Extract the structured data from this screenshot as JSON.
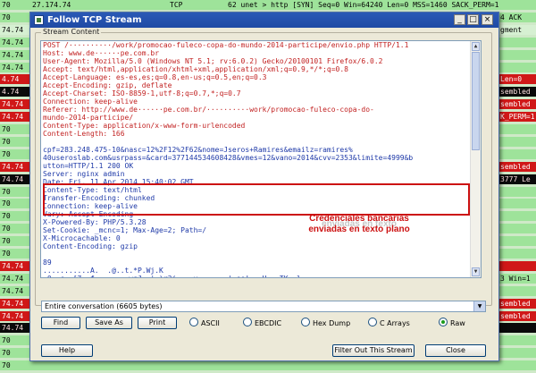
{
  "background_rows": [
    {
      "cls": "c-green",
      "no": "70",
      "src": "27.174.74",
      "proto": "TCP",
      "info": "62 unet > http [SYN] Seq=0 Win=64240 Len=0 MSS=1460 SACK_PERM=1"
    },
    {
      "cls": "c-green",
      "no": "70",
      "src": "",
      "proto": "",
      "info": "4 ACK"
    },
    {
      "cls": "c-pale",
      "no": "74.74",
      "src": "",
      "proto": "",
      "info": "gment"
    },
    {
      "cls": "c-green",
      "no": "74.74",
      "src": "",
      "proto": "",
      "info": ""
    },
    {
      "cls": "c-green",
      "no": "74.74",
      "src": "",
      "proto": "",
      "info": ""
    },
    {
      "cls": "c-green",
      "no": "74.74",
      "src": "",
      "proto": "",
      "info": ""
    },
    {
      "cls": "c-red",
      "no": "4.74",
      "src": "",
      "proto": "",
      "info": "Len=0"
    },
    {
      "cls": "c-black",
      "no": "4.74",
      "src": "",
      "proto": "",
      "info": "sembled"
    },
    {
      "cls": "c-red",
      "no": "74.74",
      "src": "",
      "proto": "",
      "info": "sembled"
    },
    {
      "cls": "c-red",
      "no": "74.74",
      "src": "",
      "proto": "",
      "info": "K_PERM=1"
    },
    {
      "cls": "c-green",
      "no": "70",
      "src": "",
      "proto": "",
      "info": ""
    },
    {
      "cls": "c-green",
      "no": "70",
      "src": "",
      "proto": "",
      "info": ""
    },
    {
      "cls": "c-green",
      "no": "70",
      "src": "",
      "proto": "",
      "info": ""
    },
    {
      "cls": "c-red",
      "no": "74.74",
      "src": "",
      "proto": "",
      "info": "sembled"
    },
    {
      "cls": "c-black",
      "no": "74.74",
      "src": "",
      "proto": "",
      "info": "3777 Le"
    },
    {
      "cls": "c-green",
      "no": "70",
      "src": "",
      "proto": "",
      "info": ""
    },
    {
      "cls": "c-green",
      "no": "70",
      "src": "",
      "proto": "",
      "info": ""
    },
    {
      "cls": "c-green",
      "no": "70",
      "src": "",
      "proto": "",
      "info": ""
    },
    {
      "cls": "c-green",
      "no": "70",
      "src": "",
      "proto": "",
      "info": ""
    },
    {
      "cls": "c-green",
      "no": "70",
      "src": "",
      "proto": "",
      "info": ""
    },
    {
      "cls": "c-green",
      "no": "70",
      "src": "",
      "proto": "",
      "info": ""
    },
    {
      "cls": "c-red",
      "no": "74.74",
      "src": "",
      "proto": "",
      "info": ""
    },
    {
      "cls": "c-green",
      "no": "74.74",
      "src": "",
      "proto": "",
      "info": "3 Win=1"
    },
    {
      "cls": "c-green",
      "no": "74.74",
      "src": "",
      "proto": "",
      "info": ""
    },
    {
      "cls": "c-red",
      "no": "74.74",
      "src": "",
      "proto": "",
      "info": "sembled"
    },
    {
      "cls": "c-red",
      "no": "74.74",
      "src": "",
      "proto": "",
      "info": "sembled"
    },
    {
      "cls": "c-black",
      "no": "74.74",
      "src": "",
      "proto": "",
      "info": ""
    },
    {
      "cls": "c-green",
      "no": "70",
      "src": "",
      "proto": "",
      "info": ""
    },
    {
      "cls": "c-green",
      "no": "70",
      "src": "",
      "proto": "",
      "info": ""
    },
    {
      "cls": "c-green",
      "no": "70",
      "src": "",
      "proto": "",
      "info": ""
    }
  ],
  "window": {
    "title": "Follow TCP Stream",
    "minimize": "_",
    "maximize": "□",
    "close": "×",
    "group_label": "Stream Content"
  },
  "stream_lines": [
    {
      "c": "red",
      "t": "POST /··········/work/promocao-fuleco-copa-do-mundo-2014-participe/envio.php HTTP/1.1"
    },
    {
      "c": "red",
      "t": "Host: www.de······pe.com.br"
    },
    {
      "c": "red",
      "t": "User-Agent: Mozilla/5.0 (Windows NT 5.1; rv:6.0.2) Gecko/20100101 Firefox/6.0.2"
    },
    {
      "c": "red",
      "t": "Accept: text/html,application/xhtml+xml,application/xml;q=0.9,*/*;q=0.8"
    },
    {
      "c": "red",
      "t": "Accept-Language: es-es,es;q=0.8,en-us;q=0.5,en;q=0.3"
    },
    {
      "c": "red",
      "t": "Accept-Encoding: gzip, deflate"
    },
    {
      "c": "red",
      "t": "Accept-Charset: ISO-8859-1,utf-8;q=0.7,*;q=0.7"
    },
    {
      "c": "red",
      "t": "Connection: keep-alive"
    },
    {
      "c": "red",
      "t": "Referer: http://www.de······pe.com.br/··········work/promocao-fuleco-copa-do-"
    },
    {
      "c": "red",
      "t": "mundo-2014-participe/"
    },
    {
      "c": "red",
      "t": "Content-Type: application/x-www-form-urlencoded"
    },
    {
      "c": "red",
      "t": "Content-Length: 166"
    },
    {
      "c": "red",
      "t": ""
    },
    {
      "c": "blue",
      "t": "cpf=283.248.475-10&nasc=12%2F12%2F62&nome=Jseros+Ramires&emailz=ramires%"
    },
    {
      "c": "blue",
      "t": "40useroslab.com&usrpass=&card=377144534608428&vmes=12&vano=2014&cvv=2353&limite=4999&b"
    },
    {
      "c": "blue",
      "t": "utton=HTTP/1.1 200 OK"
    },
    {
      "c": "blue",
      "t": "Server: nginx admin"
    },
    {
      "c": "blue",
      "t": "Date: Fri, 11 Apr 2014 15:40:02 GMT"
    },
    {
      "c": "blue",
      "t": "Content-Type: text/html"
    },
    {
      "c": "blue",
      "t": "Transfer-Encoding: chunked"
    },
    {
      "c": "blue",
      "t": "Connection: keep-alive"
    },
    {
      "c": "blue",
      "t": "Vary: Accept-Encoding"
    },
    {
      "c": "blue",
      "t": "X-Powered-By: PHP/5.3.28"
    },
    {
      "c": "blue",
      "t": "Set-Cookie: _mcnc=1; Max-Age=2; Path=/"
    },
    {
      "c": "blue",
      "t": "X-Microcachable: 0"
    },
    {
      "c": "blue",
      "t": "Content-Encoding: gzip"
    },
    {
      "c": "blue",
      "t": ""
    },
    {
      "c": "blue",
      "t": "89"
    },
    {
      "c": "blue",
      "t": "...........A.  .@..t.*P.Wj.K"
    },
    {
      "c": "blue",
      "t": ".0..c..[7..f........wqJ..'.)r3j....u.......'.ee!...U...TK..l..."
    },
    {
      "c": "blue",
      "t": "(W.....'CdAH.......t...A...Pxb.....!uw......"
    }
  ],
  "annotation": {
    "line1": "Credenciales bancarias",
    "line2": "enviadas en texto plano",
    "shadow": "enviadas en texto"
  },
  "conversation_select": "Entire conversation (6605 bytes)",
  "buttons": {
    "find": "Find",
    "save_as": "Save As",
    "print": "Print",
    "help": "Help",
    "filter_out": "Filter Out This Stream",
    "close": "Close"
  },
  "radios": [
    {
      "label": "ASCII",
      "checked": false
    },
    {
      "label": "EBCDIC",
      "checked": false
    },
    {
      "label": "Hex Dump",
      "checked": false
    },
    {
      "label": "C Arrays",
      "checked": false
    },
    {
      "label": "Raw",
      "checked": true
    }
  ],
  "colors": {
    "title_bar": "#2356b3",
    "highlight_box": "#cc1111",
    "request_text": "#c22222",
    "response_text": "#1f3aa8"
  }
}
